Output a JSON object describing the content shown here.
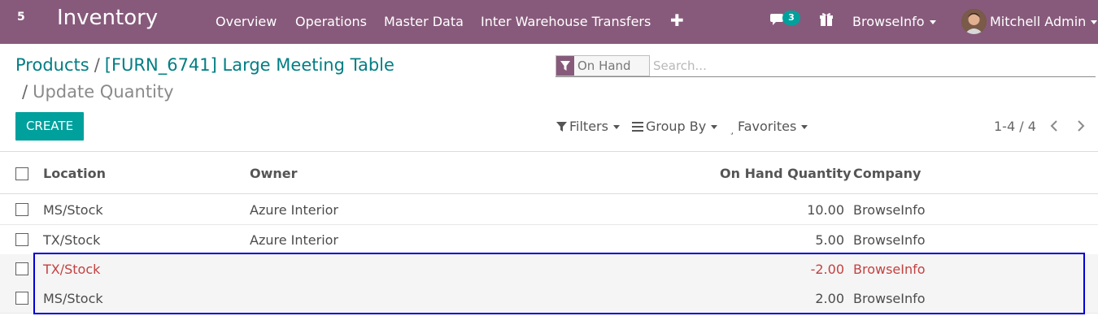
{
  "navbar": {
    "apps_indicator": "5",
    "brand": "Inventory",
    "menu": [
      "Overview",
      "Operations",
      "Master Data",
      "Inter Warehouse Transfers"
    ],
    "plus_icon": "plus-icon",
    "chat_badge": "3",
    "company": "BrowseInfo",
    "user": "Mitchell Admin"
  },
  "breadcrumb": {
    "root": "Products",
    "product": "[FURN_6741] Large Meeting Table",
    "current": "Update Quantity"
  },
  "search": {
    "facet_label": "On Hand",
    "placeholder": "Search..."
  },
  "toolbar": {
    "create_label": "CREATE",
    "filters_label": "Filters",
    "groupby_label": "Group By",
    "favorites_label": "Favorites",
    "pager": "1-4 / 4"
  },
  "list": {
    "columns": [
      "Location",
      "Owner",
      "On Hand Quantity",
      "Company"
    ],
    "rows": [
      {
        "location": "MS/Stock",
        "owner": "Azure Interior",
        "qty": "10.00",
        "company": "BrowseInfo"
      },
      {
        "location": "TX/Stock",
        "owner": "Azure Interior",
        "qty": "5.00",
        "company": "BrowseInfo"
      },
      {
        "location": "TX/Stock",
        "owner": "",
        "qty": "-2.00",
        "company": "BrowseInfo"
      },
      {
        "location": "MS/Stock",
        "owner": "",
        "qty": "2.00",
        "company": "BrowseInfo"
      }
    ]
  },
  "colors": {
    "navbar": "#875a7b",
    "accent": "#00a09d",
    "link": "#017e84",
    "danger": "#c34141",
    "highlight_box": "#0000d6"
  }
}
